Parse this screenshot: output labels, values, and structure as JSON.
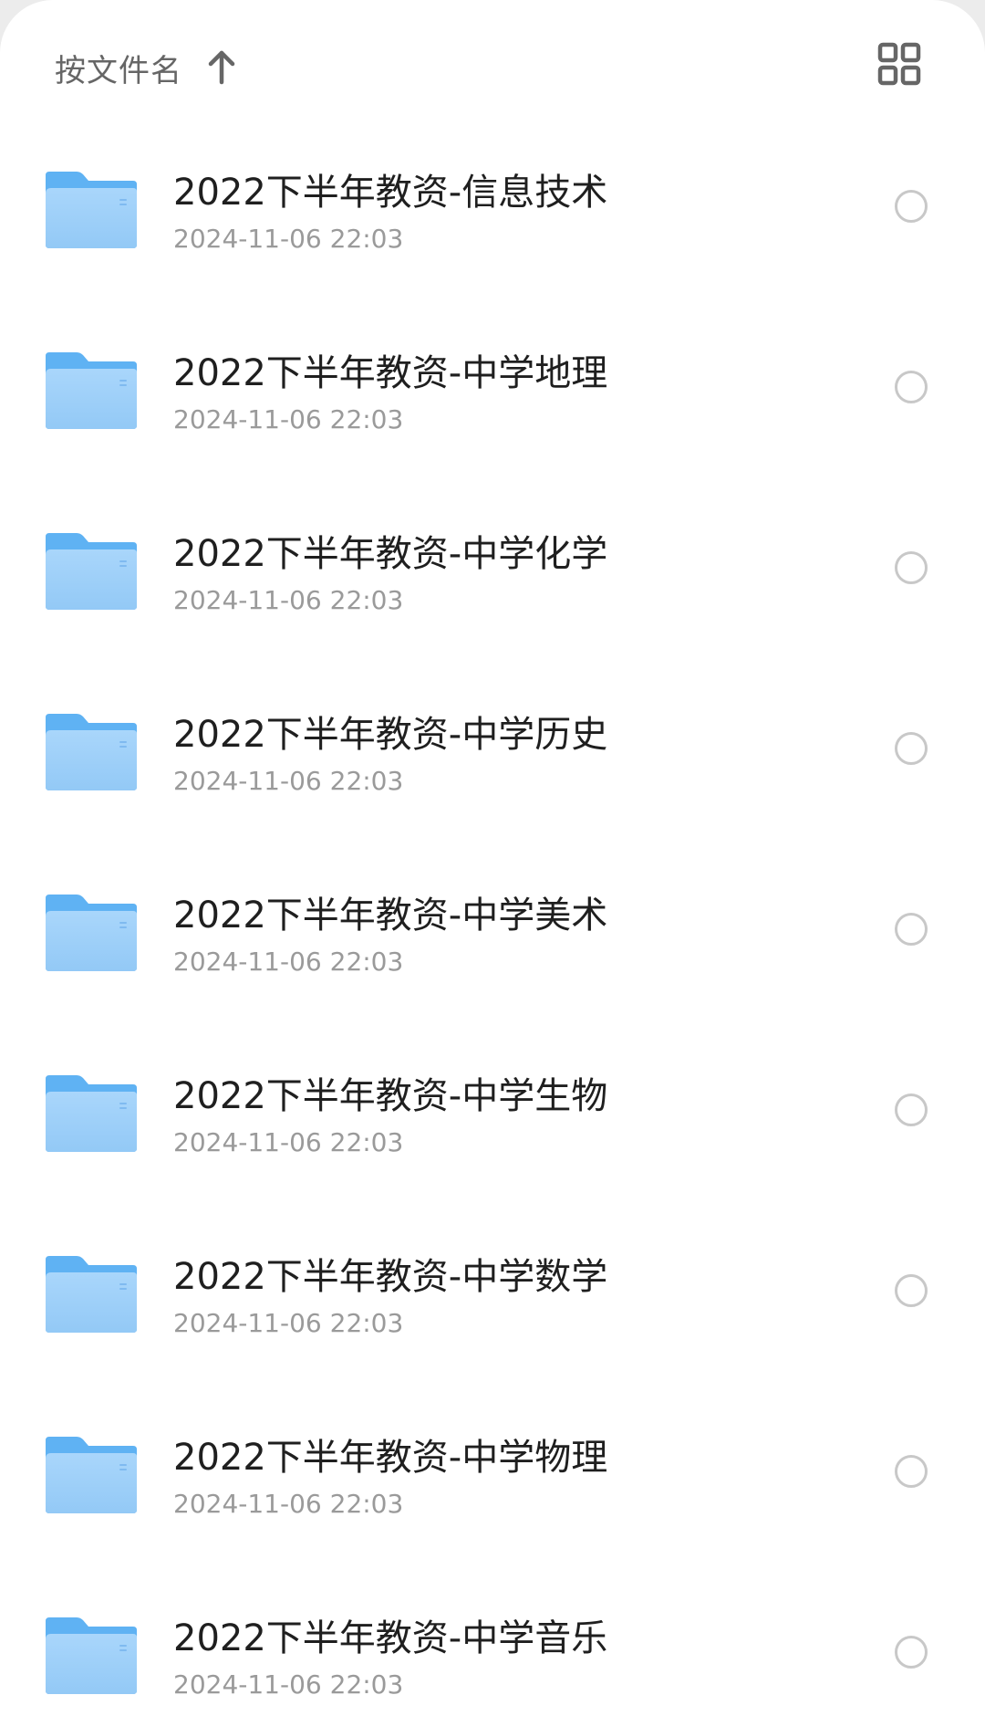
{
  "toolbar": {
    "sort_label": "按文件名",
    "sort_direction_icon": "arrow-up-icon",
    "view_toggle_icon": "grid-view-icon"
  },
  "colors": {
    "folder_front": "#a9d6fb",
    "folder_back": "#5fb2f3",
    "radio_border": "#c8c8c8",
    "name_text": "#1f1f1f",
    "date_text": "#9a9a9a"
  },
  "files": [
    {
      "name": "2022下半年教资-信息技术",
      "date": "2024-11-06 22:03",
      "icon": "folder-icon"
    },
    {
      "name": "2022下半年教资-中学地理",
      "date": "2024-11-06 22:03",
      "icon": "folder-icon"
    },
    {
      "name": "2022下半年教资-中学化学",
      "date": "2024-11-06 22:03",
      "icon": "folder-icon"
    },
    {
      "name": "2022下半年教资-中学历史",
      "date": "2024-11-06 22:03",
      "icon": "folder-icon"
    },
    {
      "name": "2022下半年教资-中学美术",
      "date": "2024-11-06 22:03",
      "icon": "folder-icon"
    },
    {
      "name": "2022下半年教资-中学生物",
      "date": "2024-11-06 22:03",
      "icon": "folder-icon"
    },
    {
      "name": "2022下半年教资-中学数学",
      "date": "2024-11-06 22:03",
      "icon": "folder-icon"
    },
    {
      "name": "2022下半年教资-中学物理",
      "date": "2024-11-06 22:03",
      "icon": "folder-icon"
    },
    {
      "name": "2022下半年教资-中学音乐",
      "date": "2024-11-06 22:03",
      "icon": "folder-icon"
    }
  ]
}
